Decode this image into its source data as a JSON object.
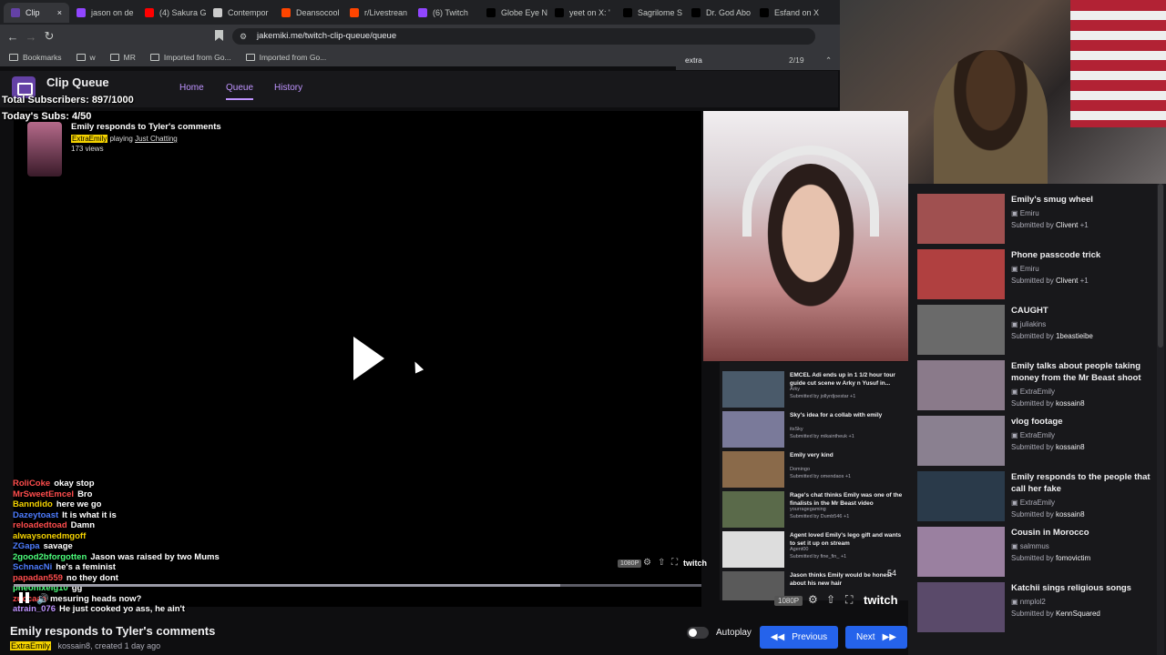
{
  "browser": {
    "tabs": [
      {
        "label": "Clip",
        "color": "#6441a5"
      },
      {
        "label": "jason on de",
        "color": "#9146ff"
      },
      {
        "label": "(4) Sakura G",
        "color": "#ff0000"
      },
      {
        "label": "Contempor",
        "color": "#cccccc"
      },
      {
        "label": "Deansocool",
        "color": "#ff4500"
      },
      {
        "label": "r/Livestrean",
        "color": "#ff4500"
      },
      {
        "label": "(6) Twitch",
        "color": "#9146ff"
      },
      {
        "label": "Globe Eye N",
        "color": "#000000"
      },
      {
        "label": "yeet on X: '",
        "color": "#000000"
      },
      {
        "label": "Sagrilome S",
        "color": "#000000"
      },
      {
        "label": "Dr. God Abo",
        "color": "#000000"
      },
      {
        "label": "Esfand on X",
        "color": "#000000"
      }
    ],
    "url": "jakemiki.me/twitch-clip-queue/queue",
    "bookmarks": [
      "Bookmarks",
      "w",
      "MR",
      "Imported from Go...",
      "Imported from Go..."
    ],
    "find": {
      "query": "extra",
      "count": "2/19"
    }
  },
  "app": {
    "title": "Clip Queue",
    "nav": [
      "Home",
      "Queue",
      "History"
    ]
  },
  "overlay": {
    "total_subs": "Total Subscribers: 897/1000",
    "today_subs": "Today's Subs: 4/50"
  },
  "clip": {
    "title": "Emily responds to Tyler's comments",
    "channel": "ExtraEmily",
    "playing_prefix": "playing",
    "game": "Just Chatting",
    "views": "173 views",
    "creator": "kossain8",
    "created": "created 1 day ago"
  },
  "chat": [
    {
      "user": "RoliCoke",
      "color": "#ff4d4d",
      "msg": "okay stop"
    },
    {
      "user": "MrSweetEmcel",
      "color": "#ff4d4d",
      "msg": "Bro"
    },
    {
      "user": "Banndido",
      "color": "#f5d300",
      "msg": "here we go"
    },
    {
      "user": "Dazeytoast",
      "color": "#4d7cff",
      "msg": "It is what it is"
    },
    {
      "user": "reloadedtoad",
      "color": "#ff4d4d",
      "msg": "Damn"
    },
    {
      "user": "alwaysonedmgoff",
      "color": "#f5d300",
      "msg": ""
    },
    {
      "user": "ZGapa",
      "color": "#4d7cff",
      "msg": "savage"
    },
    {
      "user": "2good2bforgotten",
      "color": "#4dff7c",
      "msg": "Jason was raised by two Mums"
    },
    {
      "user": "SchnacNi",
      "color": "#4d7cff",
      "msg": "he's a feminist"
    },
    {
      "user": "papadan559",
      "color": "#ff4d4d",
      "msg": "no they dont"
    },
    {
      "user": "pheonixeig10",
      "color": "#4dff7c",
      "msg": "gg"
    },
    {
      "user": "zuccaaa",
      "color": "#ff4d4d",
      "msg": "mesuring heads now?"
    },
    {
      "user": "atrain_076",
      "color": "#bf94ff",
      "msg": "He just cooked yo ass, he ain't"
    }
  ],
  "controls": {
    "autoplay": "Autoplay",
    "previous": "Previous",
    "next": "Next",
    "quality": "1080P",
    "counter": "54"
  },
  "mini_queue": [
    {
      "title": "EMCEL Adi ends up in 1 1/2 hour tour guide cut scene w Arky n Yusuf in...",
      "author": "Arky",
      "sub": "Submitted by jollyrdjoestar +1",
      "color": "#4a5a6a"
    },
    {
      "title": "Sky's idea for a collab with emily",
      "author": "itsSky",
      "sub": "Submitted by mikaintheuk +1",
      "color": "#7a7a9a"
    },
    {
      "title": "Emily very kind",
      "author": "Domingo",
      "sub": "Submitted by omendaos +1",
      "color": "#8a6a4a"
    },
    {
      "title": "Rage's chat thinks Emily was one of the finalists in the Mr Beast video",
      "author": "yourragegaming",
      "sub": "Submitted by Dumb546 +1",
      "color": "#5a6a4a"
    },
    {
      "title": "Agent loved Emily's lego gift and wants to set it up on stream",
      "author": "Agent00",
      "sub": "Submitted by fine_fin_ +1",
      "color": "#dddddd"
    },
    {
      "title": "Jason thinks Emily would be honest about his new hair",
      "author": "",
      "sub": "",
      "color": "#5a5a5a"
    }
  ],
  "queue": [
    {
      "title": "Emily's smug wheel",
      "author": "Emiru",
      "submitter": "Clivent",
      "extra": "+1",
      "color": "#a05050"
    },
    {
      "title": "Phone passcode trick",
      "author": "Emiru",
      "submitter": "Clivent",
      "extra": "+1",
      "color": "#b04040"
    },
    {
      "title": "CAUGHT",
      "author": "juliakins",
      "submitter": "1beastieibe",
      "extra": "",
      "color": "#6a6a6a"
    },
    {
      "title": "Emily talks about people taking money from the Mr Beast shoot",
      "author": "ExtraEmily",
      "submitter": "kossain8",
      "extra": "",
      "color": "#8a7a8a"
    },
    {
      "title": "vlog footage",
      "author": "ExtraEmily",
      "submitter": "kossain8",
      "extra": "",
      "color": "#8a8090"
    },
    {
      "title": "Emily responds to the people that call her fake",
      "author": "ExtraEmily",
      "submitter": "kossain8",
      "extra": "",
      "color": "#2a3a4a"
    },
    {
      "title": "Cousin in Morocco",
      "author": "salmmus",
      "submitter": "fomovictim",
      "extra": "",
      "color": "#9a80a0"
    },
    {
      "title": "Katchii sings religious songs",
      "author": "nmplol2",
      "submitter": "KennSquared",
      "extra": "",
      "color": "#5a4a6a"
    }
  ],
  "labels": {
    "submitted_by": "Submitted by"
  }
}
